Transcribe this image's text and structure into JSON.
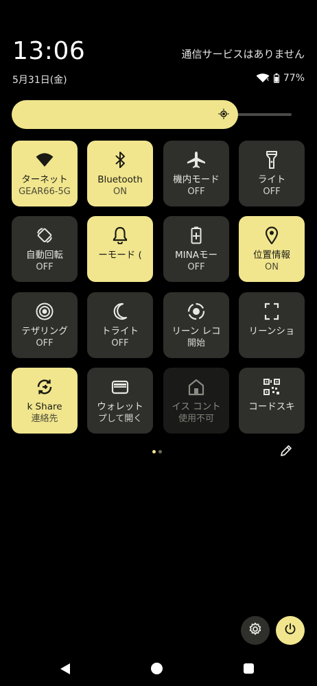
{
  "status": {
    "time": "13:06",
    "carrier": "通信サービスはありません",
    "date": "5月31日(金)",
    "battery": "77%"
  },
  "brightness": {
    "level_percent": 80
  },
  "tiles": [
    {
      "label": "ターネット",
      "state": "GEAR66-5G",
      "icon": "wifi-icon",
      "active": "on"
    },
    {
      "label": "Bluetooth",
      "state": "ON",
      "icon": "bluetooth-icon",
      "active": "on"
    },
    {
      "label": "機内モード",
      "state": "OFF",
      "icon": "airplane-icon",
      "active": "off"
    },
    {
      "label": "ライト",
      "state": "OFF",
      "icon": "flashlight-icon",
      "active": "off"
    },
    {
      "label": "自動回転",
      "state": "OFF",
      "icon": "rotate-icon",
      "active": "off"
    },
    {
      "label": "ーモード (",
      "state": "",
      "icon": "bell-icon",
      "active": "on"
    },
    {
      "label": "MINAモー",
      "state": "OFF",
      "icon": "battery-saver-icon",
      "active": "off"
    },
    {
      "label": "位置情報",
      "state": "ON",
      "icon": "location-icon",
      "active": "on"
    },
    {
      "label": "テザリング",
      "state": "OFF",
      "icon": "hotspot-icon",
      "active": "off"
    },
    {
      "label": "トライト",
      "state": "OFF",
      "icon": "moon-icon",
      "active": "off"
    },
    {
      "label": "リーン レコ",
      "state": "開始",
      "icon": "screen-record-icon",
      "active": "off"
    },
    {
      "label": "リーンショ",
      "state": "",
      "icon": "screenshot-icon",
      "active": "off"
    },
    {
      "label": "k Share",
      "state": "連絡先",
      "icon": "quick-share-icon",
      "active": "on"
    },
    {
      "label": "ウォレット",
      "state": "プして開く",
      "icon": "wallet-icon",
      "active": "off"
    },
    {
      "label": "イス コント",
      "state": "使用不可",
      "icon": "home-icon",
      "active": "dis"
    },
    {
      "label": "コードスキ",
      "state": "",
      "icon": "qr-code-icon",
      "active": "off"
    }
  ],
  "colors": {
    "accent": "#f1e68e",
    "tile_off": "#2f2f2b",
    "tile_disabled": "#1a1a18",
    "background": "#000000"
  },
  "pager": {
    "page": 1,
    "pages": 2
  }
}
